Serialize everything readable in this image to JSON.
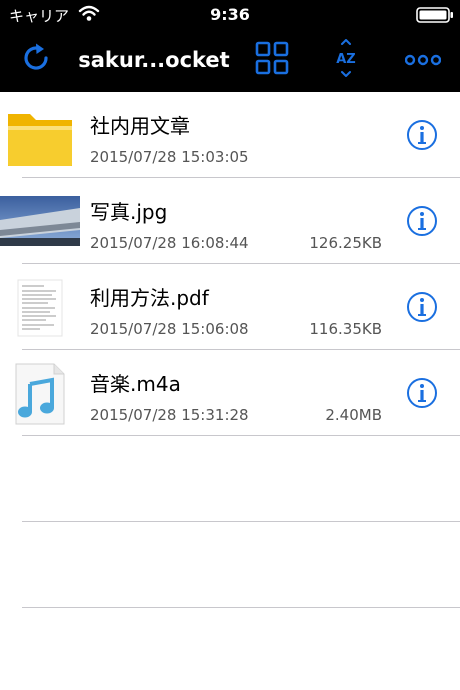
{
  "status_bar": {
    "carrier": "キャリア",
    "time": "9:36"
  },
  "nav": {
    "title": "sakur...ocket"
  },
  "files": [
    {
      "name": "社内用文章",
      "date": "2015/07/28 15:03:05",
      "size": "",
      "kind": "folder"
    },
    {
      "name": "写真.jpg",
      "date": "2015/07/28 16:08:44",
      "size": "126.25KB",
      "kind": "image"
    },
    {
      "name": "利用方法.pdf",
      "date": "2015/07/28 15:06:08",
      "size": "116.35KB",
      "kind": "pdf"
    },
    {
      "name": "音楽.m4a",
      "date": "2015/07/28 15:31:28",
      "size": "2.40MB",
      "kind": "audio"
    }
  ],
  "colors": {
    "accent": "#1a6fe0",
    "folder": "#f5c518"
  }
}
